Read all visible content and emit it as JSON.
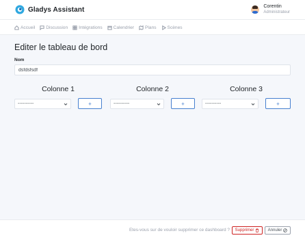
{
  "app": {
    "brand_name": "Gladys Assistant",
    "logo_icon": "gladys-logo-icon"
  },
  "user": {
    "name": "Corentin",
    "role": "Administrateur",
    "avatar_icon": "user-avatar"
  },
  "nav": {
    "items": [
      {
        "label": "Accueil",
        "icon": "home-icon"
      },
      {
        "label": "Discussion",
        "icon": "chat-icon"
      },
      {
        "label": "Intégrations",
        "icon": "grid-icon"
      },
      {
        "label": "Calendrier",
        "icon": "calendar-icon"
      },
      {
        "label": "Plans",
        "icon": "map-icon"
      },
      {
        "label": "Scènes",
        "icon": "play-icon"
      }
    ]
  },
  "page": {
    "title": "Editer le tableau de bord",
    "name_label": "Nom",
    "name_value": "dsfdsfsdf"
  },
  "columns": [
    {
      "title": "Colonne 1",
      "select_value": "----------",
      "add_label": "+"
    },
    {
      "title": "Colonne 2",
      "select_value": "----------",
      "add_label": "+"
    },
    {
      "title": "Colonne 3",
      "select_value": "----------",
      "add_label": "+"
    }
  ],
  "footer": {
    "confirm_text": "Etes-vous sur de vouloir supprimer ce dashboard ?",
    "delete_label": "Supprimer",
    "cancel_label": "Annuler"
  },
  "colors": {
    "primary": "#467fcf",
    "danger": "#cd201f",
    "background": "#f5f7fb",
    "muted": "#9aa0ac"
  }
}
